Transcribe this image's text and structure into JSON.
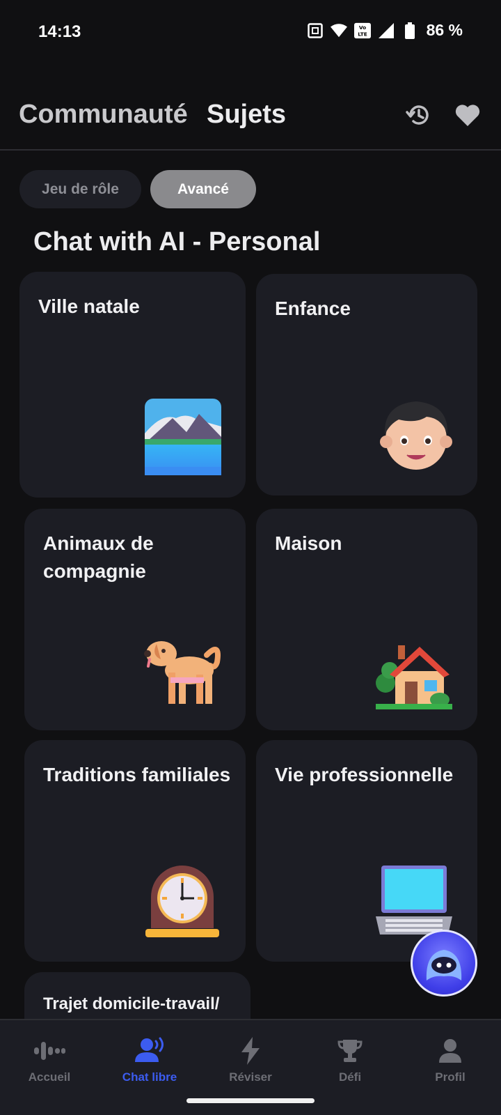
{
  "status_bar": {
    "time": "14:13",
    "battery_text": "86 %",
    "icons": [
      "nfc-icon",
      "wifi-icon",
      "volte-icon",
      "signal-icon",
      "battery-icon"
    ]
  },
  "header": {
    "tab_community": "Communauté",
    "tab_topics": "Sujets",
    "icons": [
      "history-icon",
      "heart-icon"
    ]
  },
  "chips": {
    "roleplay": "Jeu de rôle",
    "advanced": "Avancé"
  },
  "section_title": "Chat with AI - Personal",
  "cards": [
    {
      "title": "Ville natale",
      "icon": "mountain-lake-icon"
    },
    {
      "title": "Enfance",
      "icon": "boy-face-icon"
    },
    {
      "title": "Animaux de compagnie",
      "icon": "dog-icon"
    },
    {
      "title": "Maison",
      "icon": "house-icon"
    },
    {
      "title": "Traditions familiales",
      "icon": "mantel-clock-icon"
    },
    {
      "title": "Vie professionnelle",
      "icon": "laptop-icon"
    },
    {
      "title": "Trajet domicile-travail/",
      "icon": ""
    }
  ],
  "fab": {
    "icon": "bot-icon"
  },
  "bottom_nav": {
    "items": [
      {
        "label": "Accueil",
        "icon": "voice-wave-icon"
      },
      {
        "label": "Chat libre",
        "icon": "chat-speaker-icon",
        "active": true
      },
      {
        "label": "Réviser",
        "icon": "lightning-icon"
      },
      {
        "label": "Défi",
        "icon": "trophy-icon"
      },
      {
        "label": "Profil",
        "icon": "person-icon"
      }
    ]
  },
  "colors": {
    "background": "#101012",
    "card": "#1c1d24",
    "accent": "#3c5cf0",
    "chip_active": "#8a8a8d"
  }
}
